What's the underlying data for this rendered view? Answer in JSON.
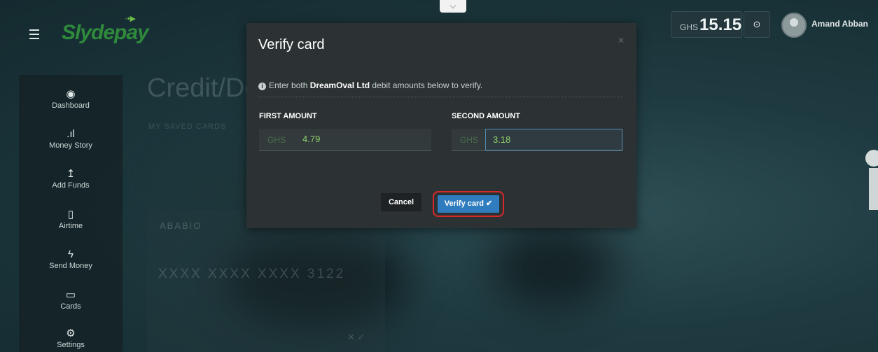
{
  "app": {
    "logo": "Slydepay"
  },
  "header": {
    "currency": "GHS",
    "balance": "15.15",
    "toggle_icon": "chevron-down-icon",
    "user_name": "Amand Abban"
  },
  "sidebar": {
    "items": [
      {
        "label": "Dashboard",
        "icon": "dashboard-icon"
      },
      {
        "label": "Money Story",
        "icon": "bar-chart-icon"
      },
      {
        "label": "Add Funds",
        "icon": "upload-icon"
      },
      {
        "label": "Airtime",
        "icon": "phone-icon"
      },
      {
        "label": "Send Money",
        "icon": "bolt-icon"
      },
      {
        "label": "Cards",
        "icon": "card-icon"
      },
      {
        "label": "Settings",
        "icon": "gears-icon"
      }
    ]
  },
  "background": {
    "title": "Credit/Debi",
    "subtitle": "MY SAVED CARDS",
    "card_name": "ABABIO",
    "card_number": "XXXX XXXX XXXX 3122"
  },
  "modal": {
    "title": "Verify card",
    "info_prefix": "Enter both ",
    "info_company": "DreamOval Ltd",
    "info_suffix": " debit amounts below to verify.",
    "first_label": "FIRST AMOUNT",
    "second_label": "SECOND AMOUNT",
    "currency": "GHS",
    "first_value": "4.79",
    "second_value": "3.18",
    "cancel_label": "Cancel",
    "verify_label": "Verify card ✔"
  }
}
